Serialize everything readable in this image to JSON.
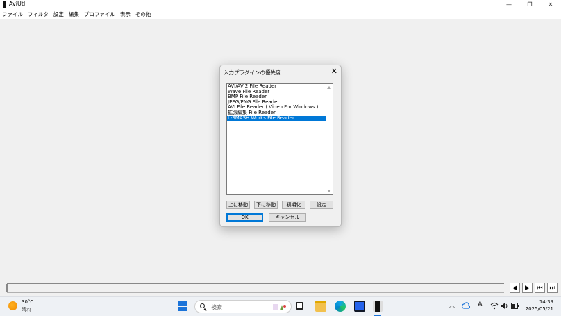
{
  "window": {
    "title": "AviUtl",
    "minimize_icon": "—",
    "maximize_icon": "❐",
    "close_icon": "✕"
  },
  "menu": {
    "items": [
      "ファイル",
      "フィルタ",
      "設定",
      "編集",
      "プロファイル",
      "表示",
      "その他"
    ]
  },
  "dialog": {
    "title": "入力プラグインの優先度",
    "close_icon": "✕",
    "plugins": [
      "AVI/AVI2 File Reader",
      "Wave File Reader",
      "BMP File Reader",
      "JPEG/PNG File Reader",
      "AVI File Reader ( Video For Windows )",
      "拡張編集 File Reader",
      "L-SMASH Works File Reader"
    ],
    "selected_index": 6,
    "buttons": {
      "move_up": "上に移動",
      "move_down": "下に移動",
      "reset": "初期化",
      "settings": "設定",
      "ok": "OK",
      "cancel": "キャンセル"
    }
  },
  "nav_buttons": {
    "prev_frame": "◀",
    "next_frame": "▶",
    "first_frame": "⏮",
    "last_frame": "⏭"
  },
  "taskbar": {
    "weather": {
      "temp": "30°C",
      "desc": "晴れ"
    },
    "search_placeholder": "検索",
    "tray_text_icon": "A",
    "time": "14:39",
    "date": "2025/05/21"
  },
  "colors": {
    "selection": "#0078d7",
    "start_blue": "#1a73d9",
    "dialog_bg": "#f0f0f0"
  }
}
